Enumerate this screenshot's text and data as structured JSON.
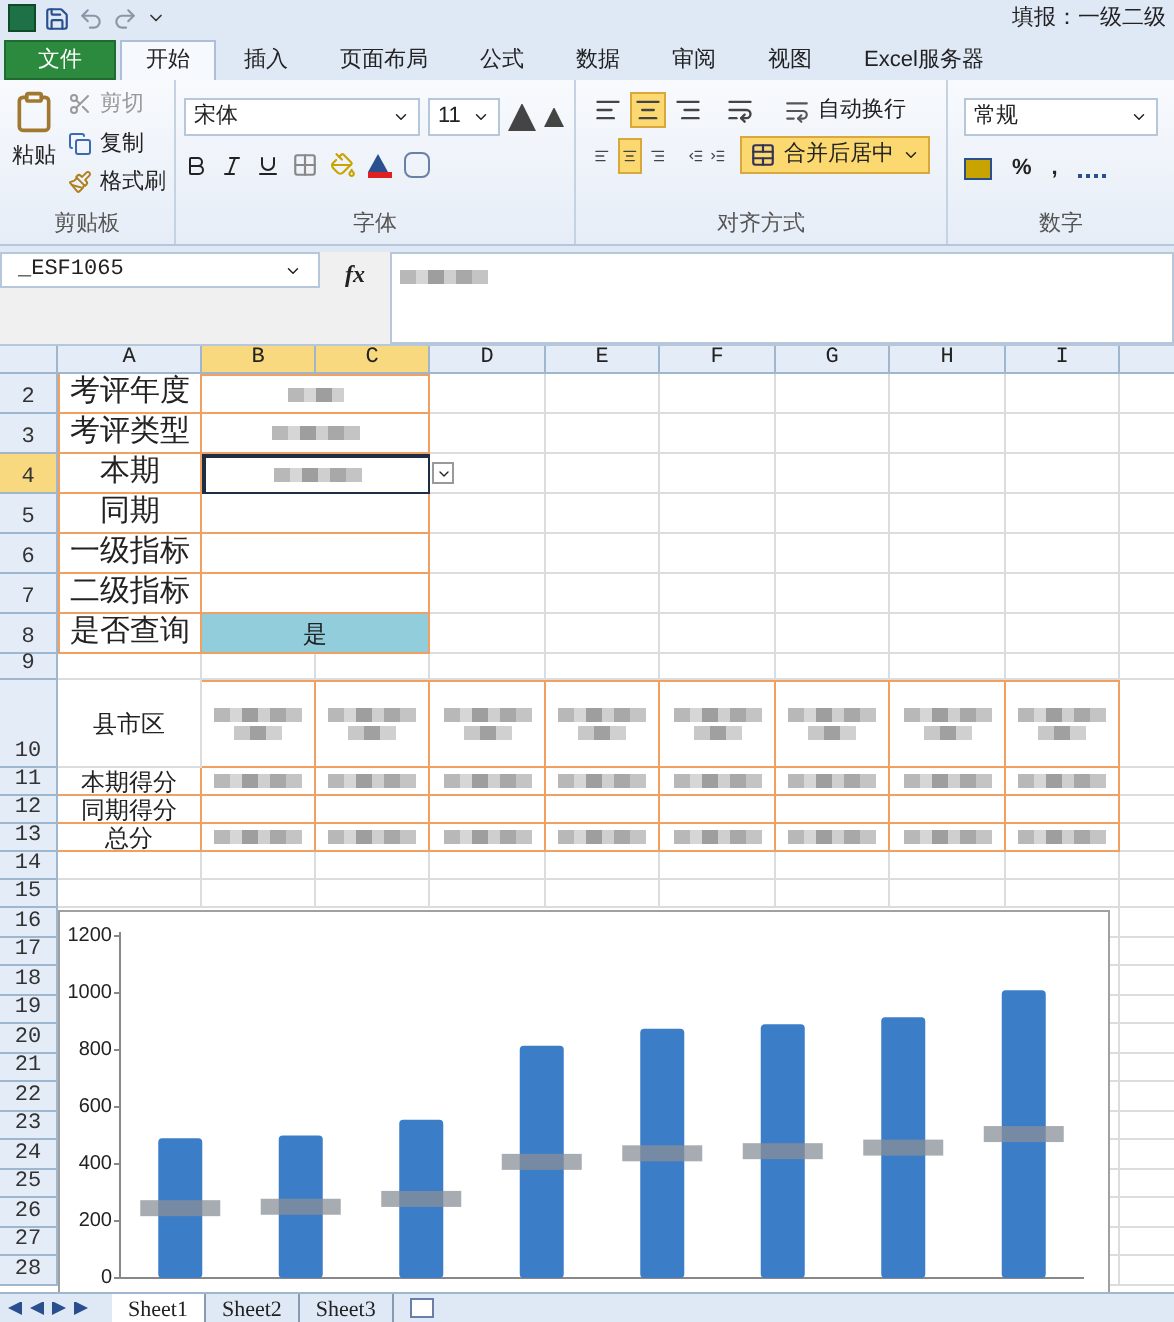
{
  "title_bar": {
    "title": "填报：一级二级"
  },
  "tabs": [
    {
      "label": "文件",
      "kind": "file",
      "selected": false
    },
    {
      "label": "开始",
      "kind": "tab",
      "selected": true
    },
    {
      "label": "插入",
      "kind": "tab",
      "selected": false
    },
    {
      "label": "页面布局",
      "kind": "tab",
      "selected": false
    },
    {
      "label": "公式",
      "kind": "tab",
      "selected": false
    },
    {
      "label": "数据",
      "kind": "tab",
      "selected": false
    },
    {
      "label": "审阅",
      "kind": "tab",
      "selected": false
    },
    {
      "label": "视图",
      "kind": "tab",
      "selected": false
    },
    {
      "label": "Excel服务器",
      "kind": "tab",
      "selected": false
    }
  ],
  "clipboard": {
    "paste": "粘贴",
    "cut": {
      "label": "剪切",
      "disabled": true
    },
    "copy": "复制",
    "format_painter": "格式刷",
    "label": "剪贴板"
  },
  "font": {
    "name": "宋体",
    "size": "11",
    "label": "字体"
  },
  "alignment": {
    "middle_selected": true,
    "center_selected": true,
    "wrap": "自动换行",
    "merge": {
      "label": "合并后居中",
      "selected": true
    },
    "label": "对齐方式"
  },
  "number": {
    "format": "常规",
    "percent": "%",
    "comma": ",",
    "label": "数字"
  },
  "formula_bar": {
    "name_box": "_ESF1065",
    "fx": "fx",
    "value_blurred": true
  },
  "columns": [
    {
      "label": "A",
      "selected": false
    },
    {
      "label": "B",
      "selected": true
    },
    {
      "label": "C",
      "selected": true
    },
    {
      "label": "D",
      "selected": false
    },
    {
      "label": "E",
      "selected": false
    },
    {
      "label": "F",
      "selected": false
    },
    {
      "label": "G",
      "selected": false
    },
    {
      "label": "H",
      "selected": false
    },
    {
      "label": "I",
      "selected": false
    }
  ],
  "row_numbers": [
    {
      "label": "2",
      "selected": false
    },
    {
      "label": "3",
      "selected": false
    },
    {
      "label": "4",
      "selected": true
    },
    {
      "label": "5",
      "selected": false
    },
    {
      "label": "6",
      "selected": false
    },
    {
      "label": "7",
      "selected": false
    },
    {
      "label": "8",
      "selected": false
    },
    {
      "label": "9",
      "selected": false
    },
    {
      "label": "10",
      "selected": false
    },
    {
      "label": "11",
      "selected": false
    },
    {
      "label": "12",
      "selected": false
    },
    {
      "label": "13",
      "selected": false
    },
    {
      "label": "14",
      "selected": false
    },
    {
      "label": "15",
      "selected": false
    },
    {
      "label": "16",
      "selected": false
    },
    {
      "label": "17",
      "selected": false
    },
    {
      "label": "18",
      "selected": false
    },
    {
      "label": "19",
      "selected": false
    },
    {
      "label": "20",
      "selected": false
    },
    {
      "label": "21",
      "selected": false
    },
    {
      "label": "22",
      "selected": false
    },
    {
      "label": "23",
      "selected": false
    },
    {
      "label": "24",
      "selected": false
    },
    {
      "label": "25",
      "selected": false
    },
    {
      "label": "26",
      "selected": false
    },
    {
      "label": "27",
      "selected": false
    },
    {
      "label": "28",
      "selected": false
    }
  ],
  "form": [
    {
      "label": "考评年度",
      "kind": "blurred",
      "selected": false
    },
    {
      "label": "考评类型",
      "kind": "blurred",
      "selected": false
    },
    {
      "label": "本期",
      "kind": "blurred",
      "selected": true
    },
    {
      "label": "同期",
      "kind": "empty",
      "selected": false
    },
    {
      "label": "一级指标",
      "kind": "empty",
      "selected": false
    },
    {
      "label": "二级指标",
      "kind": "empty",
      "selected": false
    },
    {
      "label": "是否查询",
      "kind": "text",
      "value": "是",
      "selected": false
    }
  ],
  "scores": {
    "header": "县市区",
    "rows": [
      {
        "label": "本期得分",
        "blurred": true
      },
      {
        "label": "同期得分",
        "blurred": false
      },
      {
        "label": "总分",
        "blurred": true
      }
    ]
  },
  "chart": {
    "chart_data": {
      "type": "bar",
      "series": [
        {
          "color": "#3c7dc8",
          "values": [
            490,
            500,
            555,
            815,
            875,
            890,
            915,
            1010
          ]
        }
      ],
      "ylim": [
        0,
        1200
      ],
      "yticks": [
        0,
        200,
        400,
        600,
        800,
        1000,
        1200
      ]
    }
  },
  "sheet_tabs": [
    {
      "label": "Sheet1",
      "selected": true
    },
    {
      "label": "Sheet2",
      "selected": false
    },
    {
      "label": "Sheet3",
      "selected": false
    }
  ]
}
